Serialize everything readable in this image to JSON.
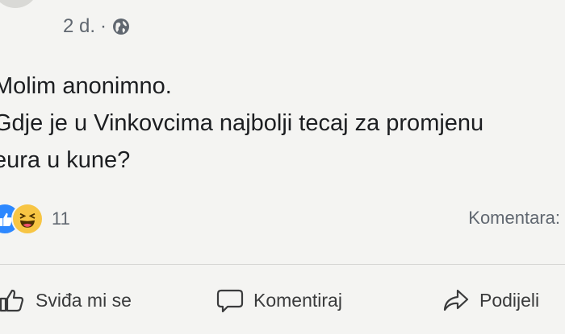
{
  "post": {
    "timestamp": "2 d.",
    "separator": "·",
    "privacy_icon": "globe-icon",
    "text_lines": [
      "Molim anonimno.",
      "Gdje je u Vinkovcima najbolji tecaj za promjenu",
      "eura u kune?"
    ]
  },
  "stats": {
    "reaction_icons": [
      "like-icon",
      "haha-icon"
    ],
    "reaction_count": "11",
    "comments_label": "Komentara:"
  },
  "actions": {
    "like_label": "Sviđa mi se",
    "comment_label": "Komentiraj",
    "share_label": "Podijeli"
  },
  "colors": {
    "background": "#f4f4f2",
    "like_blue": "#2d88ff",
    "haha_yellow": "#f7c544",
    "secondary_text": "#606770"
  }
}
